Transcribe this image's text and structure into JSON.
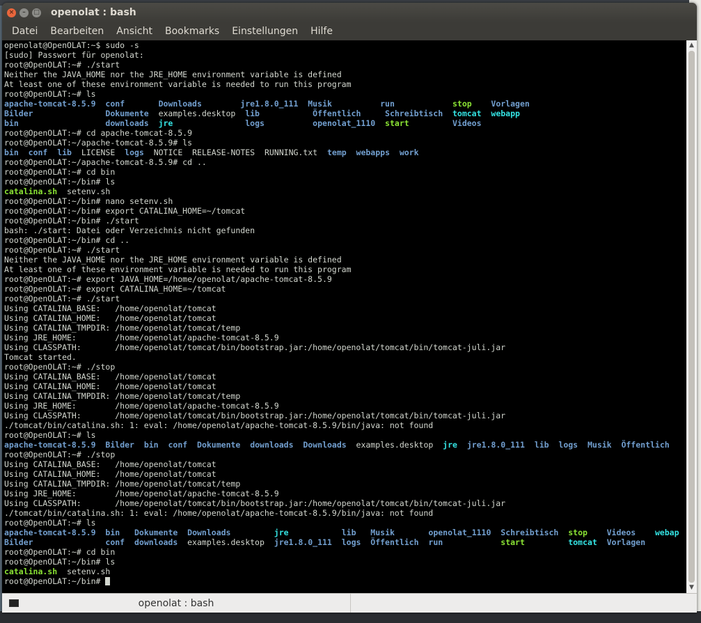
{
  "window": {
    "title": "openolat : bash",
    "close_glyph": "×",
    "min_glyph": "–",
    "max_glyph": "□"
  },
  "menubar": {
    "items": [
      "Datei",
      "Bearbeiten",
      "Ansicht",
      "Bookmarks",
      "Einstellungen",
      "Hilfe"
    ]
  },
  "tab": {
    "label": "openolat : bash",
    "icon": "terminal-icon"
  },
  "colors": {
    "directory": "#729fcf",
    "executable": "#8ae234",
    "symlink": "#34e2e2",
    "text": "#d3d7cf",
    "background": "#000000"
  },
  "terminal": {
    "lines": [
      [
        {
          "t": "openolat@OpenOLAT:~$ sudo -s"
        }
      ],
      [
        {
          "t": "[sudo] Passwort für openolat:"
        }
      ],
      [
        {
          "t": "root@OpenOLAT:~# ./start"
        }
      ],
      [
        {
          "t": "Neither the JAVA_HOME nor the JRE_HOME environment variable is defined"
        }
      ],
      [
        {
          "t": "At least one of these environment variable is needed to run this program"
        }
      ],
      [
        {
          "t": "root@OpenOLAT:~# ls"
        }
      ],
      [
        {
          "t": "apache-tomcat-8.5.9",
          "c": "b"
        },
        {
          "t": "  "
        },
        {
          "t": "conf",
          "c": "b"
        },
        {
          "t": "       "
        },
        {
          "t": "Downloads",
          "c": "b"
        },
        {
          "t": "        "
        },
        {
          "t": "jre1.8.0_111",
          "c": "b"
        },
        {
          "t": "  "
        },
        {
          "t": "Musik",
          "c": "b"
        },
        {
          "t": "          "
        },
        {
          "t": "run",
          "c": "b"
        },
        {
          "t": "            "
        },
        {
          "t": "stop",
          "c": "g"
        },
        {
          "t": "    "
        },
        {
          "t": "Vorlagen",
          "c": "b"
        }
      ],
      [
        {
          "t": "Bilder",
          "c": "b"
        },
        {
          "t": "               "
        },
        {
          "t": "Dokumente",
          "c": "b"
        },
        {
          "t": "  examples.desktop  "
        },
        {
          "t": "lib",
          "c": "b"
        },
        {
          "t": "           "
        },
        {
          "t": "Öffentlich",
          "c": "b"
        },
        {
          "t": "     "
        },
        {
          "t": "Schreibtisch",
          "c": "b"
        },
        {
          "t": "  "
        },
        {
          "t": "tomcat",
          "c": "c"
        },
        {
          "t": "  "
        },
        {
          "t": "webapp",
          "c": "c"
        }
      ],
      [
        {
          "t": "bin",
          "c": "b"
        },
        {
          "t": "                  "
        },
        {
          "t": "downloads",
          "c": "b"
        },
        {
          "t": "  "
        },
        {
          "t": "jre",
          "c": "c"
        },
        {
          "t": "               "
        },
        {
          "t": "logs",
          "c": "b"
        },
        {
          "t": "          "
        },
        {
          "t": "openolat_1110",
          "c": "b"
        },
        {
          "t": "  "
        },
        {
          "t": "start",
          "c": "g"
        },
        {
          "t": "         "
        },
        {
          "t": "Videos",
          "c": "b"
        }
      ],
      [
        {
          "t": "root@OpenOLAT:~# cd apache-tomcat-8.5.9"
        }
      ],
      [
        {
          "t": "root@OpenOLAT:~/apache-tomcat-8.5.9# ls"
        }
      ],
      [
        {
          "t": "bin",
          "c": "b"
        },
        {
          "t": "  "
        },
        {
          "t": "conf",
          "c": "b"
        },
        {
          "t": "  "
        },
        {
          "t": "lib",
          "c": "b"
        },
        {
          "t": "  LICENSE  "
        },
        {
          "t": "logs",
          "c": "b"
        },
        {
          "t": "  NOTICE  RELEASE-NOTES  RUNNING.txt  "
        },
        {
          "t": "temp",
          "c": "b"
        },
        {
          "t": "  "
        },
        {
          "t": "webapps",
          "c": "b"
        },
        {
          "t": "  "
        },
        {
          "t": "work",
          "c": "b"
        }
      ],
      [
        {
          "t": "root@OpenOLAT:~/apache-tomcat-8.5.9# cd .."
        }
      ],
      [
        {
          "t": "root@OpenOLAT:~# cd bin"
        }
      ],
      [
        {
          "t": "root@OpenOLAT:~/bin# ls"
        }
      ],
      [
        {
          "t": "catalina.sh",
          "c": "g"
        },
        {
          "t": "  setenv.sh"
        }
      ],
      [
        {
          "t": "root@OpenOLAT:~/bin# nano setenv.sh"
        }
      ],
      [
        {
          "t": "root@OpenOLAT:~/bin# export CATALINA_HOME=~/tomcat"
        }
      ],
      [
        {
          "t": "root@OpenOLAT:~/bin# ./start"
        }
      ],
      [
        {
          "t": "bash: ./start: Datei oder Verzeichnis nicht gefunden"
        }
      ],
      [
        {
          "t": "root@OpenOLAT:~/bin# cd .."
        }
      ],
      [
        {
          "t": "root@OpenOLAT:~# ./start"
        }
      ],
      [
        {
          "t": "Neither the JAVA_HOME nor the JRE_HOME environment variable is defined"
        }
      ],
      [
        {
          "t": "At least one of these environment variable is needed to run this program"
        }
      ],
      [
        {
          "t": "root@OpenOLAT:~# export JAVA_HOME=/home/openolat/apache-tomcat-8.5.9"
        }
      ],
      [
        {
          "t": "root@OpenOLAT:~# export CATALINA_HOME=~/tomcat"
        }
      ],
      [
        {
          "t": "root@OpenOLAT:~# ./start"
        }
      ],
      [
        {
          "t": "Using CATALINA_BASE:   /home/openolat/tomcat"
        }
      ],
      [
        {
          "t": "Using CATALINA_HOME:   /home/openolat/tomcat"
        }
      ],
      [
        {
          "t": "Using CATALINA_TMPDIR: /home/openolat/tomcat/temp"
        }
      ],
      [
        {
          "t": "Using JRE_HOME:        /home/openolat/apache-tomcat-8.5.9"
        }
      ],
      [
        {
          "t": "Using CLASSPATH:       /home/openolat/tomcat/bin/bootstrap.jar:/home/openolat/tomcat/bin/tomcat-juli.jar"
        }
      ],
      [
        {
          "t": "Tomcat started."
        }
      ],
      [
        {
          "t": "root@OpenOLAT:~# ./stop"
        }
      ],
      [
        {
          "t": "Using CATALINA_BASE:   /home/openolat/tomcat"
        }
      ],
      [
        {
          "t": "Using CATALINA_HOME:   /home/openolat/tomcat"
        }
      ],
      [
        {
          "t": "Using CATALINA_TMPDIR: /home/openolat/tomcat/temp"
        }
      ],
      [
        {
          "t": "Using JRE_HOME:        /home/openolat/apache-tomcat-8.5.9"
        }
      ],
      [
        {
          "t": "Using CLASSPATH:       /home/openolat/tomcat/bin/bootstrap.jar:/home/openolat/tomcat/bin/tomcat-juli.jar"
        }
      ],
      [
        {
          "t": "./tomcat/bin/catalina.sh: 1: eval: /home/openolat/apache-tomcat-8.5.9/bin/java: not found"
        }
      ],
      [
        {
          "t": "root@OpenOLAT:~# ls"
        }
      ],
      [
        {
          "t": "apache-tomcat-8.5.9",
          "c": "b"
        },
        {
          "t": "  "
        },
        {
          "t": "Bilder",
          "c": "b"
        },
        {
          "t": "  "
        },
        {
          "t": "bin",
          "c": "b"
        },
        {
          "t": "  "
        },
        {
          "t": "conf",
          "c": "b"
        },
        {
          "t": "  "
        },
        {
          "t": "Dokumente",
          "c": "b"
        },
        {
          "t": "  "
        },
        {
          "t": "downloads",
          "c": "b"
        },
        {
          "t": "  "
        },
        {
          "t": "Downloads",
          "c": "b"
        },
        {
          "t": "  examples.desktop  "
        },
        {
          "t": "jre",
          "c": "c"
        },
        {
          "t": "  "
        },
        {
          "t": "jre1.8.0_111",
          "c": "b"
        },
        {
          "t": "  "
        },
        {
          "t": "lib",
          "c": "b"
        },
        {
          "t": "  "
        },
        {
          "t": "logs",
          "c": "b"
        },
        {
          "t": "  "
        },
        {
          "t": "Musik",
          "c": "b"
        },
        {
          "t": "  "
        },
        {
          "t": "Öffentlich",
          "c": "b"
        }
      ],
      [
        {
          "t": "root@OpenOLAT:~# ./stop"
        }
      ],
      [
        {
          "t": "Using CATALINA_BASE:   /home/openolat/tomcat"
        }
      ],
      [
        {
          "t": "Using CATALINA_HOME:   /home/openolat/tomcat"
        }
      ],
      [
        {
          "t": "Using CATALINA_TMPDIR: /home/openolat/tomcat/temp"
        }
      ],
      [
        {
          "t": "Using JRE_HOME:        /home/openolat/apache-tomcat-8.5.9"
        }
      ],
      [
        {
          "t": "Using CLASSPATH:       /home/openolat/tomcat/bin/bootstrap.jar:/home/openolat/tomcat/bin/tomcat-juli.jar"
        }
      ],
      [
        {
          "t": "./tomcat/bin/catalina.sh: 1: eval: /home/openolat/apache-tomcat-8.5.9/bin/java: not found"
        }
      ],
      [
        {
          "t": "root@OpenOLAT:~# ls"
        }
      ],
      [
        {
          "t": "apache-tomcat-8.5.9",
          "c": "b"
        },
        {
          "t": "  "
        },
        {
          "t": "bin",
          "c": "b"
        },
        {
          "t": "   "
        },
        {
          "t": "Dokumente",
          "c": "b"
        },
        {
          "t": "  "
        },
        {
          "t": "Downloads",
          "c": "b"
        },
        {
          "t": "         "
        },
        {
          "t": "jre",
          "c": "c"
        },
        {
          "t": "           "
        },
        {
          "t": "lib",
          "c": "b"
        },
        {
          "t": "   "
        },
        {
          "t": "Musik",
          "c": "b"
        },
        {
          "t": "       "
        },
        {
          "t": "openolat_1110",
          "c": "b"
        },
        {
          "t": "  "
        },
        {
          "t": "Schreibtisch",
          "c": "b"
        },
        {
          "t": "  "
        },
        {
          "t": "stop",
          "c": "g"
        },
        {
          "t": "    "
        },
        {
          "t": "Videos",
          "c": "b"
        },
        {
          "t": "    "
        },
        {
          "t": "webap",
          "c": "c"
        }
      ],
      [
        {
          "t": "Bilder",
          "c": "b"
        },
        {
          "t": "               "
        },
        {
          "t": "conf",
          "c": "b"
        },
        {
          "t": "  "
        },
        {
          "t": "downloads",
          "c": "b"
        },
        {
          "t": "  examples.desktop  "
        },
        {
          "t": "jre1.8.0_111",
          "c": "b"
        },
        {
          "t": "  "
        },
        {
          "t": "logs",
          "c": "b"
        },
        {
          "t": "  "
        },
        {
          "t": "Öffentlich",
          "c": "b"
        },
        {
          "t": "  "
        },
        {
          "t": "run",
          "c": "b"
        },
        {
          "t": "            "
        },
        {
          "t": "start",
          "c": "g"
        },
        {
          "t": "         "
        },
        {
          "t": "tomcat",
          "c": "c"
        },
        {
          "t": "  "
        },
        {
          "t": "Vorlagen",
          "c": "b"
        }
      ],
      [
        {
          "t": "root@OpenOLAT:~# cd bin"
        }
      ],
      [
        {
          "t": "root@OpenOLAT:~/bin# ls"
        }
      ],
      [
        {
          "t": "catalina.sh",
          "c": "g"
        },
        {
          "t": "  setenv.sh"
        }
      ],
      [
        {
          "t": "root@OpenOLAT:~/bin# "
        },
        {
          "cursor": true
        }
      ]
    ]
  }
}
